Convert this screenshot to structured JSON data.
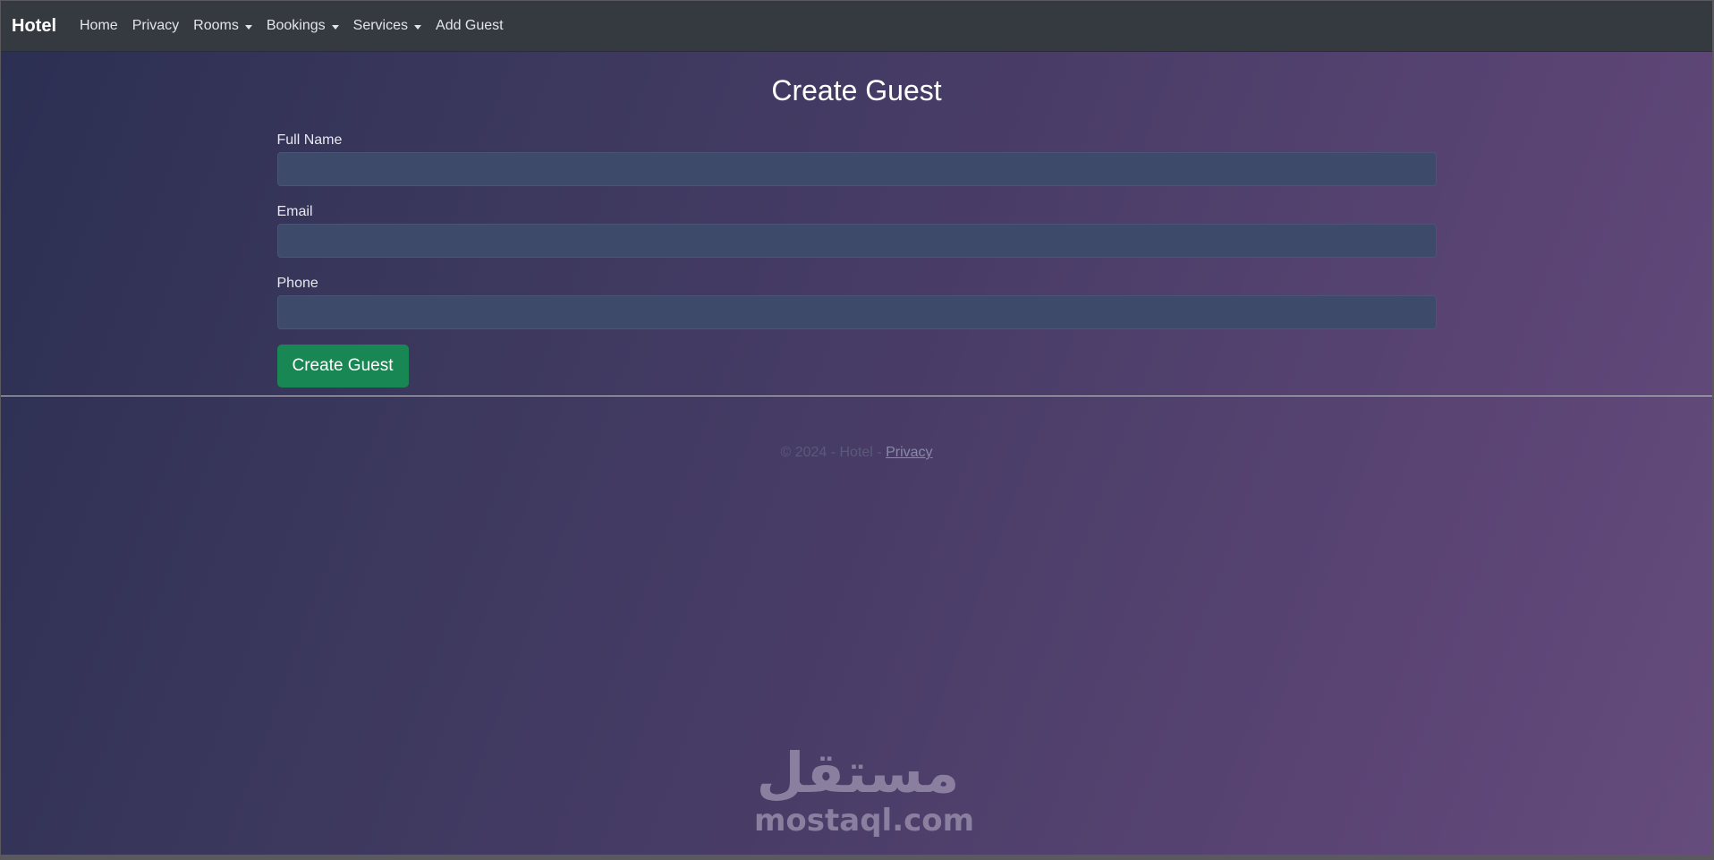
{
  "navbar": {
    "brand": "Hotel",
    "items": [
      {
        "label": "Home",
        "dropdown": false
      },
      {
        "label": "Privacy",
        "dropdown": false
      },
      {
        "label": "Rooms",
        "dropdown": true
      },
      {
        "label": "Bookings",
        "dropdown": true
      },
      {
        "label": "Services",
        "dropdown": true
      },
      {
        "label": "Add Guest",
        "dropdown": false
      }
    ]
  },
  "form": {
    "title": "Create Guest",
    "fields": [
      {
        "label": "Full Name",
        "value": "",
        "placeholder": ""
      },
      {
        "label": "Email",
        "value": "",
        "placeholder": ""
      },
      {
        "label": "Phone",
        "value": "",
        "placeholder": ""
      }
    ],
    "submit_label": "Create Guest"
  },
  "footer": {
    "text": "© 2024 - Hotel - ",
    "privacy_link": "Privacy"
  },
  "watermark": {
    "arabic": "مستقل",
    "latin": "mostaql.com"
  },
  "colors": {
    "navbar_bg": "#343a40",
    "button_bg": "#198754",
    "input_bg": "#3e4a6a"
  }
}
